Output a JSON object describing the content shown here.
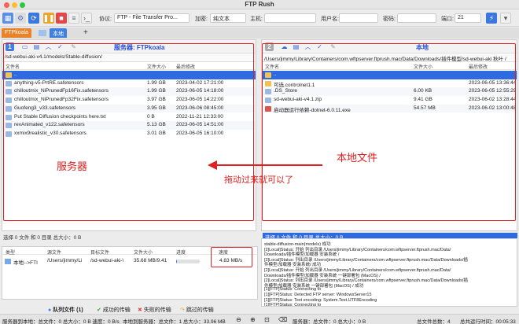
{
  "window": {
    "title": "FTP Rush"
  },
  "toolbar": {
    "protocol_label": "协议:",
    "protocol_value": "FTP - File Transfer Pro...",
    "encrypt_label": "加密:",
    "encrypt_value": "纯文本",
    "host_label": "主机:",
    "host_value": "",
    "user_label": "用户名:",
    "user_value": "",
    "pass_label": "密码:",
    "pass_value": "",
    "port_label": "端口:",
    "port_value": "21"
  },
  "tabs": [
    {
      "label": "FTPkoala"
    },
    {
      "label": "本地"
    }
  ],
  "tab_add": "+",
  "left_pane": {
    "badge": "1",
    "title": "服务器: FTPkoala",
    "path": "/sd-webui-aki-v4.1/models/Stable-diffusion/",
    "columns": [
      "文件名",
      "文件大小",
      "最后修改"
    ],
    "rows": [
      {
        "name": "..",
        "size": "",
        "date": ""
      },
      {
        "name": "anything-v5-PrtRE.safetensors",
        "size": "1.99 GB",
        "date": "2023-04-02 17:21:00"
      },
      {
        "name": "chilloutmix_NiPrunedFp16Fix.safetensors",
        "size": "1.99 GB",
        "date": "2023-06-05 14:18:00"
      },
      {
        "name": "chilloutmix_NiPrunedFp32Fix.safetensors",
        "size": "3.97 GB",
        "date": "2023-06-05 14:22:00"
      },
      {
        "name": "Guofeng3_v33.safetensors",
        "size": "3.95 GB",
        "date": "2023-06-06 08:45:00"
      },
      {
        "name": "Put Stable Diffusion checkpoints here.txt",
        "size": "0 B",
        "date": "2022-11-21 12:33:00"
      },
      {
        "name": "revAnimated_v122.safetensors",
        "size": "5.13 GB",
        "date": "2023-06-05 14:51:00"
      },
      {
        "name": "xxmix9realistic_v30.safetensors",
        "size": "3.01 GB",
        "date": "2023-06-05 16:10:00"
      }
    ],
    "status": "选择 0 文件 和 0 目录 总大小：0 B"
  },
  "right_pane": {
    "badge": "2",
    "title": "本地",
    "path": "/Users/jimmy/Library/Containers/com.wftpserver.ftprush.mac/Data/Downloads/插件模型/sd-webui-aki 秋叶 /",
    "columns": [
      "文件名",
      "文件大小",
      "最后修改"
    ],
    "rows": [
      {
        "name": "..",
        "size": "",
        "date": ""
      },
      {
        "name": "可选.controlnet1.1",
        "size": "",
        "date": "2023-06-05 13:36:44"
      },
      {
        "name": ".DS_Store",
        "size": "6.00 KB",
        "date": "2023-06-05 12:55:29"
      },
      {
        "name": "sd-webui-aki-v4.1.zip",
        "size": "9.41 GB",
        "date": "2023-06-02 13:28:44"
      },
      {
        "name": "启动器运行依赖-dotnet-6.0.11.exe",
        "size": "54.57 MB",
        "date": "2023-06-02 13:00:48"
      }
    ],
    "status": "选择 0 文件 和 0 目录 总大小：0 B"
  },
  "annotations": {
    "server": "服务器",
    "local": "本地文件",
    "drag": "拖动过来就可以了"
  },
  "queue": {
    "columns": [
      "类型",
      "源文件",
      "目标文件",
      "文件大小",
      "进度",
      "速度"
    ],
    "row": {
      "type": "本地-->FTI",
      "source": "/Users/jimmy/Li",
      "target": "/sd-webui-aki-\\",
      "size": "35.68 MB/9.41",
      "progress": 0.03,
      "speed": "4.83 MB/s"
    }
  },
  "log_lines": [
    "stable-diffusion-main(models) 成功",
    "[2]Local]Status:           开始 列出目录 /Users/jimmy/Library/Containers/com.wftpserver.ftprush.mac/Data/",
    "Downloads/插件模型/加载器  安装系统 /",
    "[2]Local]Status:           列出目录 /Users/jimmy/Library/Containers/com.wftpserver.ftprush.mac/Data/Downloads/插",
    "件模型/加载器  安装系统/ 成功",
    "[2]Local]Status:           开始 列出目录 /Users/jimmy/Library/Containers/com.wftpserver.ftprush.mac/Data/",
    "Downloads/插件模型/加载器  安装系统 一键部署包 (MacOS) /",
    "[2]Local]Status:           列出目录 /Users/jimmy/Library/Containers/com.wftpserver.ftprush.mac/Data/Downloads/插",
    "件模型/加载器  安装系统 一键部署包 (MacOS) / 成功",
    "[1][FTP]Status:            Connecting to",
    "[1][FTP]Status:            Detected FTP server: WindowsServer15",
    "[1][FTP]Status:            Text encoding: System.Text.UTF8Encoding",
    "[1][FTP]Status:            Connecting to"
  ],
  "bottom_tabs": [
    "队列文件 (1)",
    "成功的传输",
    "失败的传输",
    "跳过的传输"
  ],
  "statusbar": {
    "left": "服务器到本地：总文件：0 总大小：0 B 速度：0 B/s",
    "mid": "本地到服务器：总文件：1 总大小：33.96 MB",
    "right_label": "服务器：总文件：0 总大小：0 B",
    "total": "总文件总数：4",
    "elapsed": "总共运行时间：00:05:33"
  },
  "colors": {
    "accent_blue": "#2a4fd6",
    "selected_row": "#2f6be0",
    "annotation_red": "#e02020",
    "tab_orange": "#e8832a",
    "tab_blue": "#3f7fe0"
  }
}
